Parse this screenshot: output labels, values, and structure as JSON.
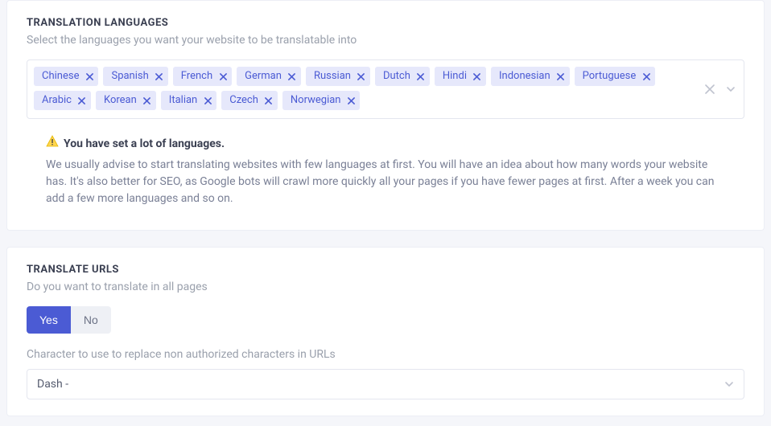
{
  "translation": {
    "title": "TRANSLATION LANGUAGES",
    "subtitle": "Select the languages you want your website to be translatable into",
    "tags": [
      "Chinese",
      "Spanish",
      "French",
      "German",
      "Russian",
      "Dutch",
      "Hindi",
      "Indonesian",
      "Portuguese",
      "Arabic",
      "Korean",
      "Italian",
      "Czech",
      "Norwegian"
    ],
    "warning_title": "You have set a lot of languages.",
    "warning_body": "We usually advise to start translating websites with few languages at first. You will have an idea about how many words your website has. It's also better for SEO, as Google bots will crawl more quickly all your pages if you have fewer pages at first. After a week you can add a few more languages and so on."
  },
  "urls": {
    "title": "TRANSLATE URLS",
    "subtitle": "Do you want to translate in all pages",
    "yes_label": "Yes",
    "no_label": "No",
    "char_label": "Character to use to replace non authorized characters in URLs",
    "selected_char": "Dash -"
  }
}
